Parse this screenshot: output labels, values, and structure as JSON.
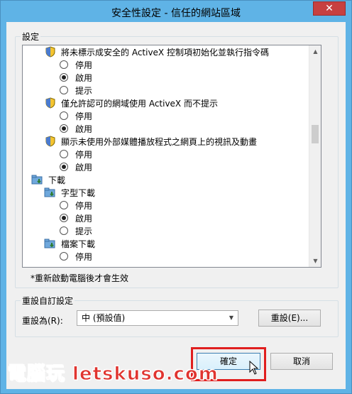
{
  "window": {
    "title": "安全性設定 - 信任的網站區域",
    "close_glyph": "✕"
  },
  "settings_group": {
    "label": "設定"
  },
  "tree": {
    "items": [
      {
        "kind": "setting",
        "label": "將未標示成安全的 ActiveX 控制項初始化並執行指令碼"
      },
      {
        "kind": "radio",
        "label": "停用",
        "checked": false
      },
      {
        "kind": "radio",
        "label": "啟用",
        "checked": true
      },
      {
        "kind": "radio",
        "label": "提示",
        "checked": false
      },
      {
        "kind": "setting",
        "label": "僅允許認可的網域使用 ActiveX 而不提示"
      },
      {
        "kind": "radio",
        "label": "停用",
        "checked": false
      },
      {
        "kind": "radio",
        "label": "啟用",
        "checked": true
      },
      {
        "kind": "setting",
        "label": "顯示未使用外部媒體播放程式之網頁上的視訊及動畫"
      },
      {
        "kind": "radio",
        "label": "停用",
        "checked": false
      },
      {
        "kind": "radio",
        "label": "啟用",
        "checked": true
      },
      {
        "kind": "category",
        "label": "下載"
      },
      {
        "kind": "subcategory",
        "label": "字型下載"
      },
      {
        "kind": "radio",
        "label": "停用",
        "checked": false
      },
      {
        "kind": "radio",
        "label": "啟用",
        "checked": true
      },
      {
        "kind": "radio",
        "label": "提示",
        "checked": false
      },
      {
        "kind": "subcategory",
        "label": "檔案下載"
      },
      {
        "kind": "radio",
        "label": "停用",
        "checked": false
      }
    ]
  },
  "note": "*重新啟動電腦後才會生效",
  "reset_group": {
    "label": "重設自訂設定",
    "reset_to_label": "重設為(R):",
    "selected_level": "中 (預設值)",
    "reset_button": "重設(E)..."
  },
  "footer": {
    "ok_button": "確定",
    "cancel_button": "取消"
  },
  "watermark": "電腦玩 letskuso.com",
  "colors": {
    "title_bar": "#5FB3E6",
    "close_button": "#C74040",
    "highlight": "#E01E1E"
  }
}
